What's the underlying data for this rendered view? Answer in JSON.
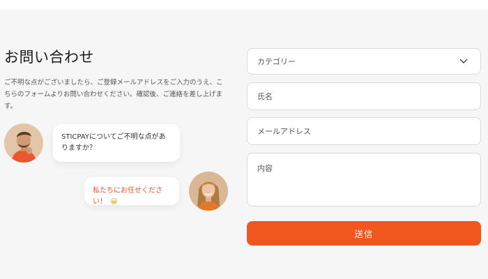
{
  "contact": {
    "title": "お問い合わせ",
    "description": "ご不明な点がございましたら、ご登録メールアドレスをご入力のうえ、こちらのフォームよりお問い合わせください。確認後、ご連絡を差し上げます。"
  },
  "chat": {
    "message_1": "STICPAYについてご不明な点がありますか？",
    "message_2": "私たちにお任せください！",
    "message_2_emoji": "😀"
  },
  "form": {
    "category_placeholder": "カテゴリー",
    "name_placeholder": "氏名",
    "email_placeholder": "メールアドレス",
    "content_placeholder": "内容",
    "submit_label": "送信"
  },
  "colors": {
    "accent": "#f0571f",
    "accent_text": "#e4572e",
    "background": "#f6f6f6"
  }
}
